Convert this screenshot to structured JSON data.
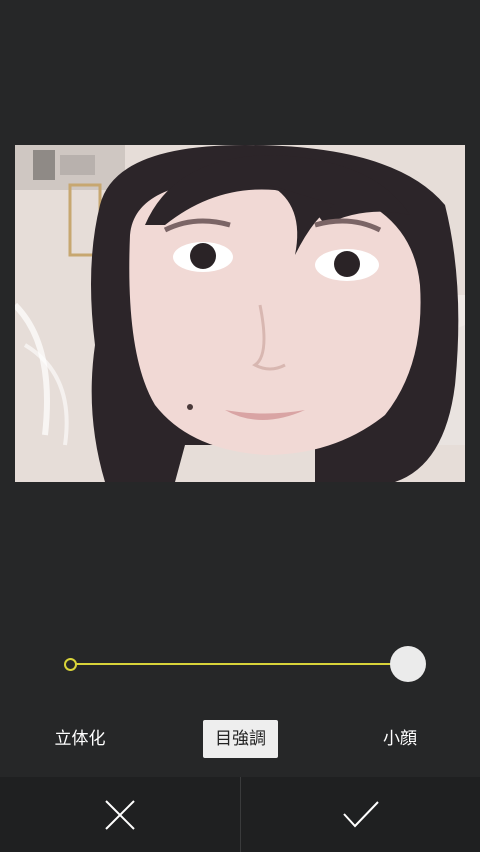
{
  "editor": {
    "photo": {
      "alt_subject": "portrait-photo"
    },
    "slider": {
      "value_fraction": 1.0
    },
    "modes": [
      {
        "label": "立体化",
        "selected": false
      },
      {
        "label": "目強調",
        "selected": true
      },
      {
        "label": "小顔",
        "selected": false
      }
    ],
    "actions": {
      "cancel_icon": "close-icon",
      "confirm_icon": "check-icon"
    },
    "colors": {
      "accent": "#d8d33a",
      "background": "#262728",
      "bottom_bar": "#1f2021",
      "selected_tab": "#eeeeee"
    }
  }
}
